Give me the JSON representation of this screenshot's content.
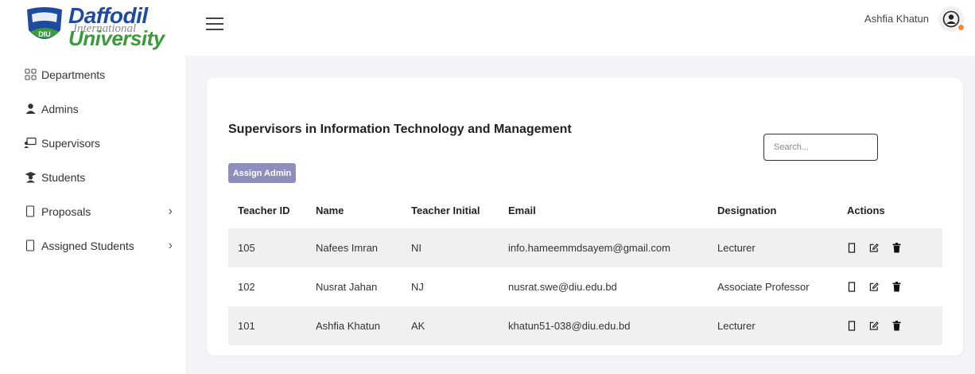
{
  "brand": {
    "name_line1": "Daffodil",
    "name_line2": "International",
    "name_line3": "University",
    "emblem_text": "DIU",
    "colors": {
      "blue": "#1e4b9e",
      "green": "#3a9b3a"
    }
  },
  "sidebar": {
    "items": [
      {
        "label": "Departments",
        "icon": "grid-icon",
        "has_submenu": false
      },
      {
        "label": "Admins",
        "icon": "user-icon",
        "has_submenu": false
      },
      {
        "label": "Supervisors",
        "icon": "presentation-icon",
        "has_submenu": false
      },
      {
        "label": "Students",
        "icon": "graduate-icon",
        "has_submenu": false
      },
      {
        "label": "Proposals",
        "icon": "document-icon",
        "has_submenu": true,
        "chevron": "›"
      },
      {
        "label": "Assigned Students",
        "icon": "document-icon",
        "has_submenu": true,
        "chevron": "›"
      }
    ]
  },
  "topbar": {
    "user_name": "Ashfia Khatun",
    "status_color": "#f08a3c"
  },
  "main": {
    "title": "Supervisors in Information Technology and Management",
    "search_placeholder": "Search...",
    "assign_button": "Assign Admin",
    "accent_color": "#8e8fbe",
    "table": {
      "headers": [
        "Teacher ID",
        "Name",
        "Teacher Initial",
        "Email",
        "Designation",
        "Actions"
      ],
      "rows": [
        [
          "105",
          "Nafees Imran",
          "NI",
          "info.hameemmdsayem@gmail.com",
          "Lecturer"
        ],
        [
          "102",
          "Nusrat Jahan",
          "NJ",
          "nusrat.swe@diu.edu.bd",
          "Associate Professor"
        ],
        [
          "101",
          "Ashfia Khatun",
          "AK",
          "khatun51-038@diu.edu.bd",
          "Lecturer"
        ]
      ],
      "row_actions": [
        "view-icon",
        "edit-icon",
        "delete-icon"
      ]
    }
  }
}
